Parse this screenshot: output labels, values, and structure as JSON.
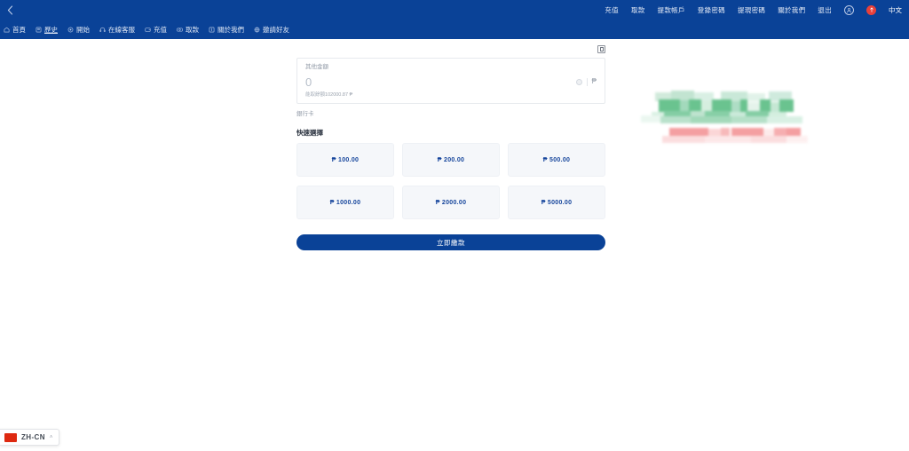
{
  "header": {
    "back_icon": "chevron-left-icon",
    "nav_items": [
      {
        "label": "充值"
      },
      {
        "label": "取款"
      },
      {
        "label": "提款帳戶"
      },
      {
        "label": "登錄密碼"
      },
      {
        "label": "提現密碼"
      },
      {
        "label": "關於我們"
      },
      {
        "label": "退出"
      }
    ],
    "avatar_icon": "user-avatar-icon",
    "alert_icon": "alert-badge-icon",
    "language_label": "中文"
  },
  "subnav": {
    "items": [
      {
        "label": "首頁",
        "icon": "home-icon",
        "active": false
      },
      {
        "label": "歷史",
        "icon": "history-icon",
        "active": true
      },
      {
        "label": "開始",
        "icon": "start-icon",
        "active": false
      },
      {
        "label": "在線客服",
        "icon": "headset-icon",
        "active": false
      },
      {
        "label": "充值",
        "icon": "wallet-icon",
        "active": false
      },
      {
        "label": "取款",
        "icon": "cash-icon",
        "active": false
      },
      {
        "label": "關於我們",
        "icon": "info-icon",
        "active": false
      },
      {
        "label": "邀請好友",
        "icon": "invite-icon",
        "active": false
      }
    ]
  },
  "form": {
    "record_icon": "transaction-record-icon",
    "amount_label": "其他金額",
    "amount_value": "0",
    "clear_icon": "clear-circle-icon",
    "currency_symbol": "₱",
    "balance_prefix": "能取餘額",
    "balance_amount": "102000.87 ₱",
    "bank_label": "銀行卡",
    "quick_title": "快速選擇",
    "quick_options": [
      {
        "label": "₱ 100.00"
      },
      {
        "label": "₱ 200.00"
      },
      {
        "label": "₱ 500.00"
      },
      {
        "label": "₱ 1000.00"
      },
      {
        "label": "₱ 2000.00"
      },
      {
        "label": "₱ 5000.00"
      }
    ],
    "submit_label": "立即繳款"
  },
  "redacted_widget": {
    "description": "pixelated-redacted-notification",
    "green_color": "#63c08a",
    "red_color": "#f4a0a2"
  },
  "language_selector": {
    "flag_icon": "china-flag-icon",
    "code": "ZH-CN",
    "chevron": "chevron-up-icon",
    "chevron_glyph": "˄"
  }
}
